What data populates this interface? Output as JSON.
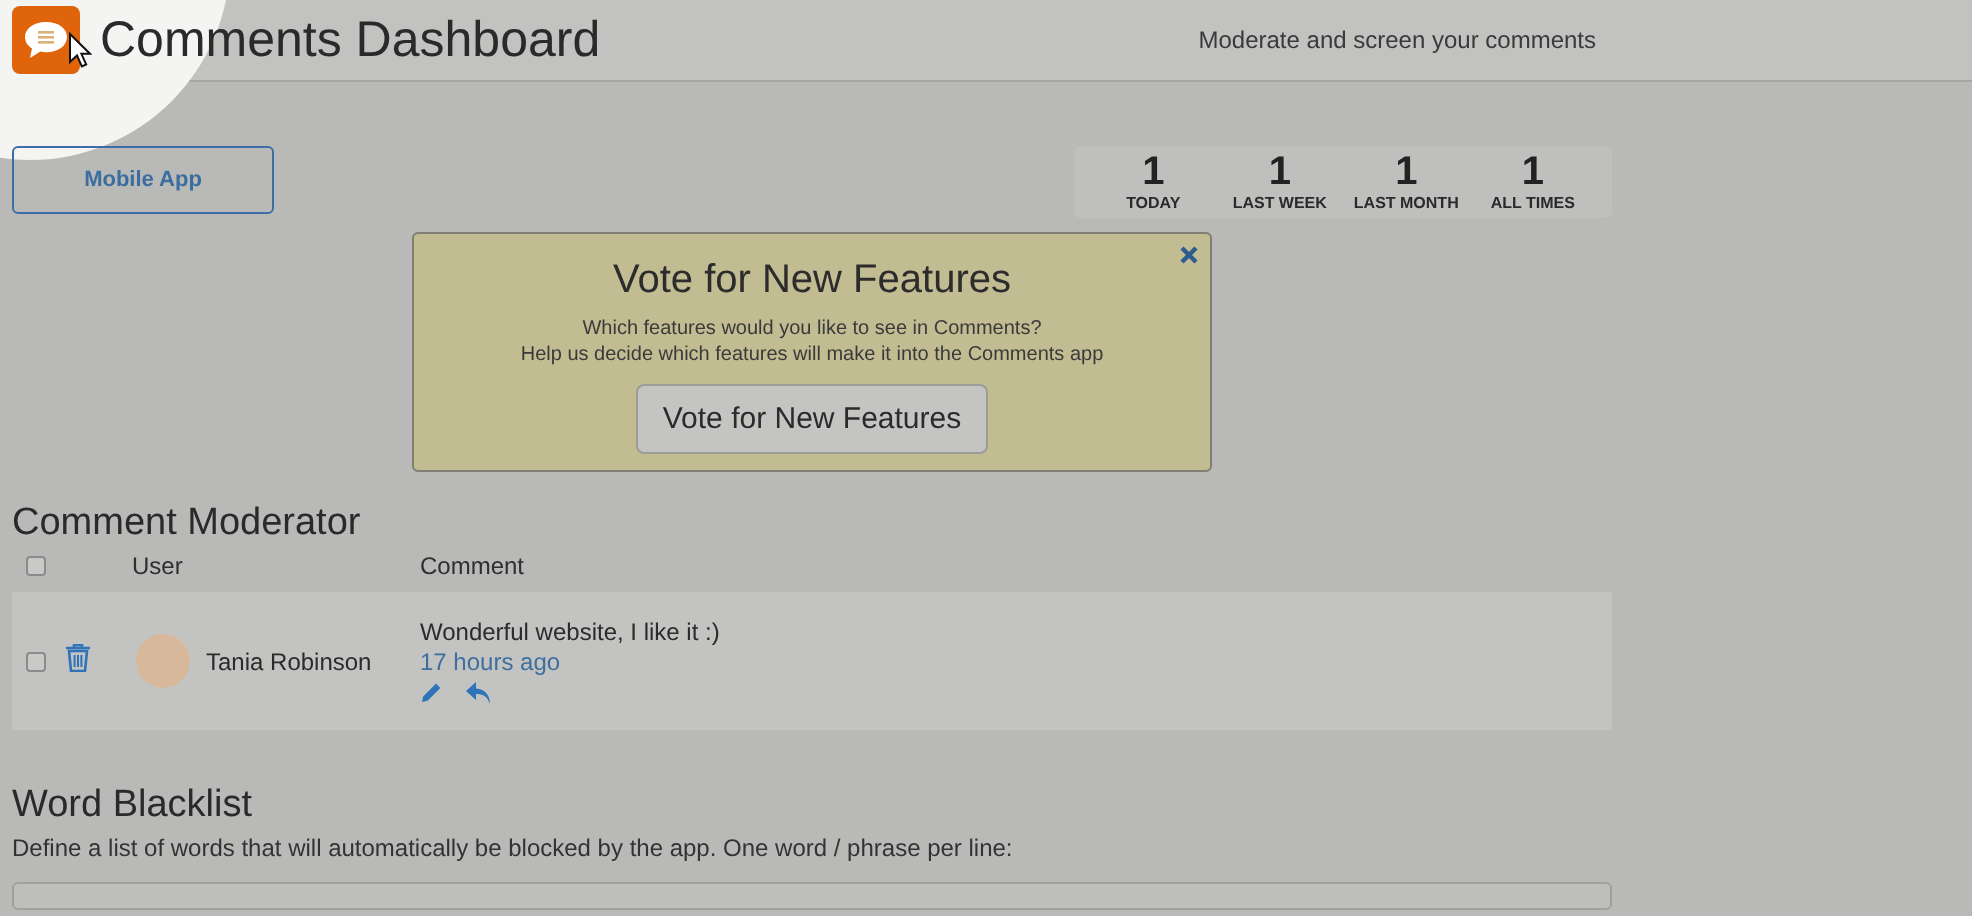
{
  "header": {
    "title": "Comments Dashboard",
    "tagline": "Moderate and screen your comments"
  },
  "mobile_button": "Mobile App",
  "stats": [
    {
      "value": "1",
      "label": "TODAY"
    },
    {
      "value": "1",
      "label": "LAST WEEK"
    },
    {
      "value": "1",
      "label": "LAST MONTH"
    },
    {
      "value": "1",
      "label": "ALL TIMES"
    }
  ],
  "vote_card": {
    "title": "Vote for New Features",
    "lines": [
      "Which features would you like to see in Comments?",
      "Help us decide which features will make it into the Comments app"
    ],
    "button": "Vote for New Features"
  },
  "moderator": {
    "title": "Comment Moderator",
    "all_checked": false,
    "columns": [
      "User",
      "Comment"
    ],
    "rows": [
      {
        "checked": false,
        "user": "Tania Robinson",
        "comment": "Wonderful website, I like it :)",
        "time": "17 hours ago"
      }
    ]
  },
  "blacklist": {
    "title": "Word Blacklist",
    "description": "Define a list of words that will automatically be blocked by the app. One word / phrase per line:"
  }
}
